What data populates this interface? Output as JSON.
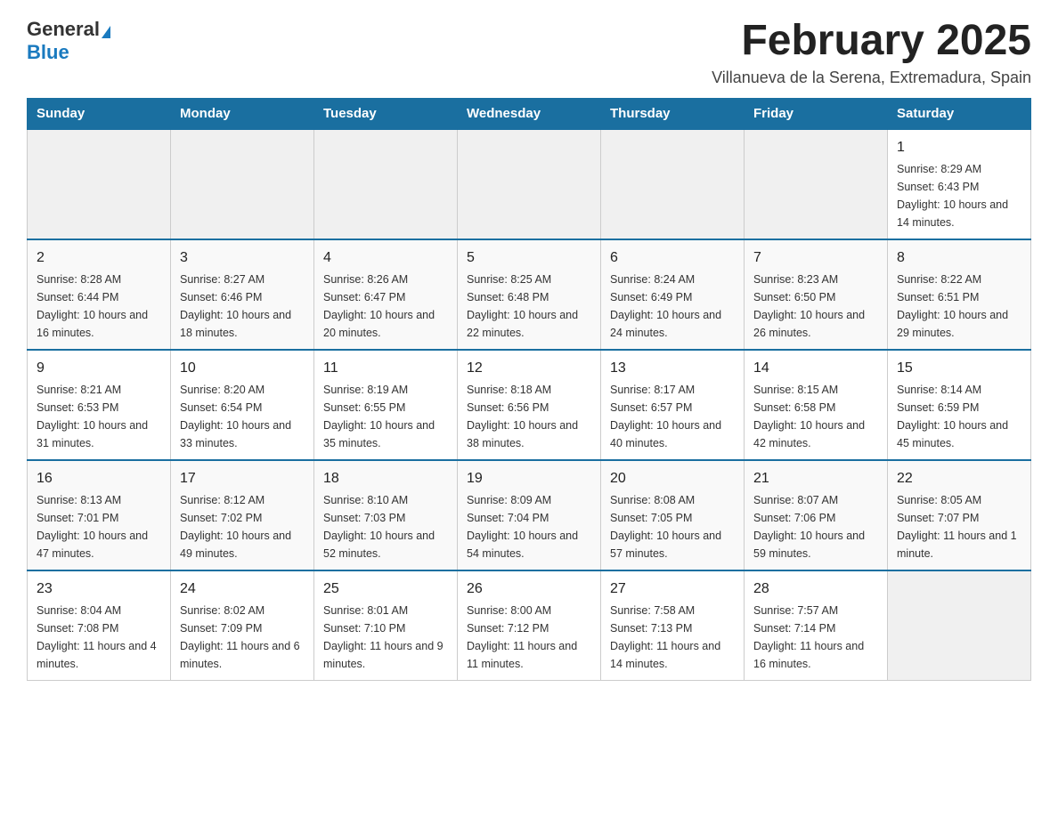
{
  "logo": {
    "general": "General",
    "blue": "Blue"
  },
  "title": "February 2025",
  "location": "Villanueva de la Serena, Extremadura, Spain",
  "weekdays": [
    "Sunday",
    "Monday",
    "Tuesday",
    "Wednesday",
    "Thursday",
    "Friday",
    "Saturday"
  ],
  "weeks": [
    [
      {
        "day": "",
        "info": ""
      },
      {
        "day": "",
        "info": ""
      },
      {
        "day": "",
        "info": ""
      },
      {
        "day": "",
        "info": ""
      },
      {
        "day": "",
        "info": ""
      },
      {
        "day": "",
        "info": ""
      },
      {
        "day": "1",
        "info": "Sunrise: 8:29 AM\nSunset: 6:43 PM\nDaylight: 10 hours and 14 minutes."
      }
    ],
    [
      {
        "day": "2",
        "info": "Sunrise: 8:28 AM\nSunset: 6:44 PM\nDaylight: 10 hours and 16 minutes."
      },
      {
        "day": "3",
        "info": "Sunrise: 8:27 AM\nSunset: 6:46 PM\nDaylight: 10 hours and 18 minutes."
      },
      {
        "day": "4",
        "info": "Sunrise: 8:26 AM\nSunset: 6:47 PM\nDaylight: 10 hours and 20 minutes."
      },
      {
        "day": "5",
        "info": "Sunrise: 8:25 AM\nSunset: 6:48 PM\nDaylight: 10 hours and 22 minutes."
      },
      {
        "day": "6",
        "info": "Sunrise: 8:24 AM\nSunset: 6:49 PM\nDaylight: 10 hours and 24 minutes."
      },
      {
        "day": "7",
        "info": "Sunrise: 8:23 AM\nSunset: 6:50 PM\nDaylight: 10 hours and 26 minutes."
      },
      {
        "day": "8",
        "info": "Sunrise: 8:22 AM\nSunset: 6:51 PM\nDaylight: 10 hours and 29 minutes."
      }
    ],
    [
      {
        "day": "9",
        "info": "Sunrise: 8:21 AM\nSunset: 6:53 PM\nDaylight: 10 hours and 31 minutes."
      },
      {
        "day": "10",
        "info": "Sunrise: 8:20 AM\nSunset: 6:54 PM\nDaylight: 10 hours and 33 minutes."
      },
      {
        "day": "11",
        "info": "Sunrise: 8:19 AM\nSunset: 6:55 PM\nDaylight: 10 hours and 35 minutes."
      },
      {
        "day": "12",
        "info": "Sunrise: 8:18 AM\nSunset: 6:56 PM\nDaylight: 10 hours and 38 minutes."
      },
      {
        "day": "13",
        "info": "Sunrise: 8:17 AM\nSunset: 6:57 PM\nDaylight: 10 hours and 40 minutes."
      },
      {
        "day": "14",
        "info": "Sunrise: 8:15 AM\nSunset: 6:58 PM\nDaylight: 10 hours and 42 minutes."
      },
      {
        "day": "15",
        "info": "Sunrise: 8:14 AM\nSunset: 6:59 PM\nDaylight: 10 hours and 45 minutes."
      }
    ],
    [
      {
        "day": "16",
        "info": "Sunrise: 8:13 AM\nSunset: 7:01 PM\nDaylight: 10 hours and 47 minutes."
      },
      {
        "day": "17",
        "info": "Sunrise: 8:12 AM\nSunset: 7:02 PM\nDaylight: 10 hours and 49 minutes."
      },
      {
        "day": "18",
        "info": "Sunrise: 8:10 AM\nSunset: 7:03 PM\nDaylight: 10 hours and 52 minutes."
      },
      {
        "day": "19",
        "info": "Sunrise: 8:09 AM\nSunset: 7:04 PM\nDaylight: 10 hours and 54 minutes."
      },
      {
        "day": "20",
        "info": "Sunrise: 8:08 AM\nSunset: 7:05 PM\nDaylight: 10 hours and 57 minutes."
      },
      {
        "day": "21",
        "info": "Sunrise: 8:07 AM\nSunset: 7:06 PM\nDaylight: 10 hours and 59 minutes."
      },
      {
        "day": "22",
        "info": "Sunrise: 8:05 AM\nSunset: 7:07 PM\nDaylight: 11 hours and 1 minute."
      }
    ],
    [
      {
        "day": "23",
        "info": "Sunrise: 8:04 AM\nSunset: 7:08 PM\nDaylight: 11 hours and 4 minutes."
      },
      {
        "day": "24",
        "info": "Sunrise: 8:02 AM\nSunset: 7:09 PM\nDaylight: 11 hours and 6 minutes."
      },
      {
        "day": "25",
        "info": "Sunrise: 8:01 AM\nSunset: 7:10 PM\nDaylight: 11 hours and 9 minutes."
      },
      {
        "day": "26",
        "info": "Sunrise: 8:00 AM\nSunset: 7:12 PM\nDaylight: 11 hours and 11 minutes."
      },
      {
        "day": "27",
        "info": "Sunrise: 7:58 AM\nSunset: 7:13 PM\nDaylight: 11 hours and 14 minutes."
      },
      {
        "day": "28",
        "info": "Sunrise: 7:57 AM\nSunset: 7:14 PM\nDaylight: 11 hours and 16 minutes."
      },
      {
        "day": "",
        "info": ""
      }
    ]
  ]
}
